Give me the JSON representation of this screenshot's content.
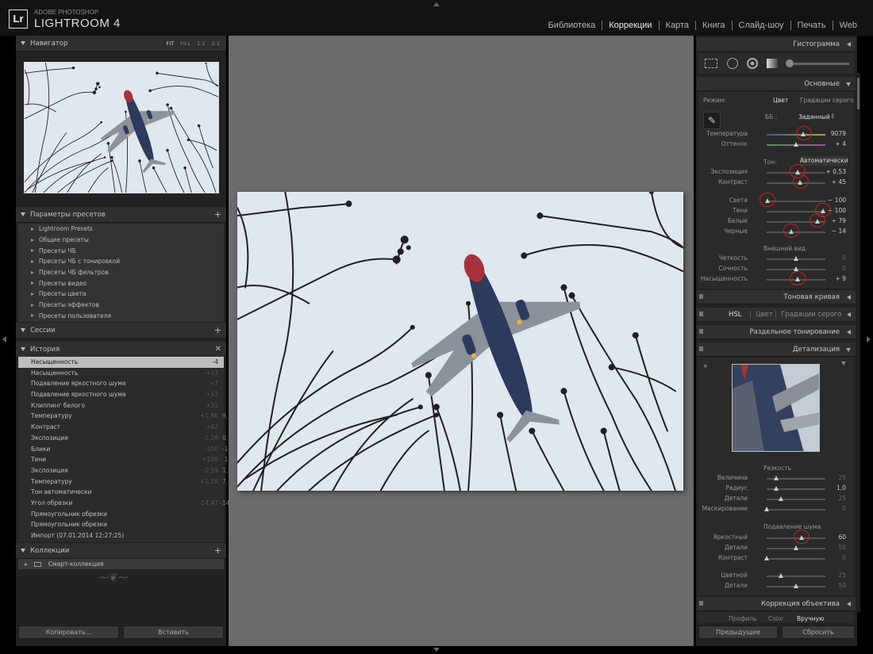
{
  "app": {
    "logo": "Lr",
    "brand_line1": "ADOBE PHOTOSHOP",
    "brand_line2": "LIGHTROOM 4"
  },
  "modules": [
    "Библиотека",
    "Коррекции",
    "Карта",
    "Книга",
    "Слайд-шоу",
    "Печать",
    "Web"
  ],
  "active_module": "Коррекции",
  "navigator": {
    "title": "Навигатор",
    "zoom": [
      "FIT",
      "FILL",
      "1:1",
      "2:1"
    ]
  },
  "presets": {
    "title": "Параметры пресетов",
    "items": [
      "Lightroom Presets",
      "Общие пресеты",
      "Пресеты ЧБ",
      "Пресеты ЧБ с тонировкой",
      "Пресеты ЧБ фильтров",
      "Пресеты видео",
      "Пресеты цвета",
      "Пресеты эффектов",
      "Пресеты пользователя"
    ]
  },
  "sessions": {
    "title": "Сессии"
  },
  "history": {
    "title": "История",
    "rows": [
      {
        "name": "Насыщенность",
        "before": "-4",
        "after": "9"
      },
      {
        "name": "Насыщенность",
        "before": "+13",
        "after": "13"
      },
      {
        "name": "Подавление яркостного шума",
        "before": "+7",
        "after": "60"
      },
      {
        "name": "Подавление яркостного шума",
        "before": "+53",
        "after": "53"
      },
      {
        "name": "Клиппинг белого",
        "before": "+31",
        "after": "79"
      },
      {
        "name": "Температуру",
        "before": "+1,8K",
        "after": "9,1K"
      },
      {
        "name": "Контраст",
        "before": "+42",
        "after": "17"
      },
      {
        "name": "Экспозиция",
        "before": "-1,28",
        "after": "0,53"
      },
      {
        "name": "Блики",
        "before": "-100",
        "after": "-100"
      },
      {
        "name": "Тени",
        "before": "+100",
        "after": "100"
      },
      {
        "name": "Экспозиция",
        "before": "-0,59",
        "after": "1,81"
      },
      {
        "name": "Температуру",
        "before": "+1,1K",
        "after": "7,3K"
      },
      {
        "name": "Тон автоматически",
        "before": "",
        "after": ""
      },
      {
        "name": "Угол обрезки",
        "before": "-14,47",
        "after": "-14,47"
      },
      {
        "name": "Прямоугольник обрезки",
        "before": "",
        "after": ""
      },
      {
        "name": "Прямоугольник обрезки",
        "before": "",
        "after": ""
      },
      {
        "name": "Импорт (07.01.2014 12:27:25)",
        "before": "",
        "after": ""
      }
    ]
  },
  "collections": {
    "title": "Коллекции",
    "smart": "Смарт-коллекция"
  },
  "buttons": {
    "copy": "Копировать...",
    "paste": "Вставить",
    "previous": "Предыдущие",
    "reset": "Сбросить"
  },
  "right": {
    "histogram": "Гистограмма",
    "basic": "Основные",
    "mode_label": "Режим:",
    "mode_color": "Цвет",
    "mode_bw": "Градации серого",
    "wb_label": "ББ :",
    "wb_value": "Заданный",
    "tone_label": "Тон:",
    "auto": "Автоматически",
    "presence": "Внешний вид",
    "sliders1": [
      {
        "label": "Температура",
        "value": "9079",
        "pos": 0.63
      },
      {
        "label": "Оттенок",
        "value": "+ 4",
        "pos": 0.5
      }
    ],
    "sliders2": [
      {
        "label": "Экспозиция",
        "value": "+ 0,53",
        "pos": 0.53
      },
      {
        "label": "Контраст",
        "value": "+ 45",
        "pos": 0.58
      }
    ],
    "sliders3": [
      {
        "label": "Света",
        "value": "− 100",
        "pos": 0.02
      },
      {
        "label": "Тени",
        "value": "+ 100",
        "pos": 0.96
      },
      {
        "label": "Белые",
        "value": "+ 79",
        "pos": 0.87
      },
      {
        "label": "Черные",
        "value": "− 14",
        "pos": 0.42
      }
    ],
    "sliders4": [
      {
        "label": "Четкость",
        "value": "0",
        "pos": 0.5
      },
      {
        "label": "Сочность",
        "value": "0",
        "pos": 0.5
      },
      {
        "label": "Насыщенность",
        "value": "+ 9",
        "pos": 0.53
      }
    ],
    "tone_curve": "Тоновая кривая",
    "hsl": "HSL",
    "hsl_color": "Цвет",
    "hsl_bw": "Градации серого",
    "split": "Раздельное тонирование",
    "detail": "Детализация",
    "sharpening": "Резкость",
    "sharp": [
      {
        "label": "Величина",
        "value": "25",
        "pos": 0.17
      },
      {
        "label": "Радиус",
        "value": "1,0",
        "pos": 0.17
      },
      {
        "label": "Детали",
        "value": "25",
        "pos": 0.25
      },
      {
        "label": "Маскирование",
        "value": "0",
        "pos": 0.0
      }
    ],
    "noise": "Подавление шума",
    "noise_sliders": [
      {
        "label": "Яркостный",
        "value": "60",
        "pos": 0.6
      },
      {
        "label": "Детали",
        "value": "50",
        "pos": 0.5
      },
      {
        "label": "Контраст",
        "value": "0",
        "pos": 0.0
      }
    ],
    "color_sliders": [
      {
        "label": "Цветной",
        "value": "25",
        "pos": 0.25
      },
      {
        "label": "Детали",
        "value": "50",
        "pos": 0.5
      }
    ],
    "lens": "Коррекция объектива",
    "lens_tabs": [
      "Профиль",
      "Color",
      "Вручную"
    ]
  }
}
